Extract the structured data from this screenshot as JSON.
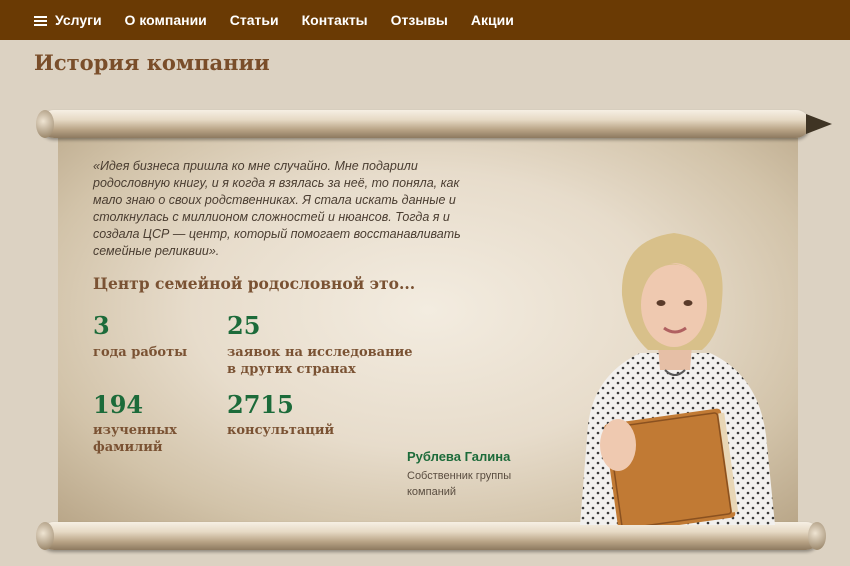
{
  "nav": {
    "items": [
      {
        "label": "Услуги",
        "icon": "menu-icon"
      },
      {
        "label": "О компании"
      },
      {
        "label": "Статьи"
      },
      {
        "label": "Контакты"
      },
      {
        "label": "Отзывы"
      },
      {
        "label": "Акции"
      }
    ]
  },
  "page": {
    "title": "История компании"
  },
  "quote": {
    "lines": [
      "«Идея бизнеса пришла ко мне случайно. Мне подарили",
      "родословную книгу, и я когда я взялась за неё, то поняла, как",
      "мало знаю о своих родственниках. Я стала искать данные и",
      "столкнулась с миллионом сложностей и нюансов. Тогда я и",
      "создала ЦСР — центр, который помогает восстанавливать",
      "семейные реликвии»."
    ]
  },
  "subtitle": "Центр семейной родословной это...",
  "stats": [
    {
      "value": "3",
      "label_lines": [
        "года работы"
      ]
    },
    {
      "value": "25",
      "label_lines": [
        "заявок на исследование",
        "в других странах"
      ]
    },
    {
      "value": "194",
      "label_lines": [
        "изученных",
        "фамилий"
      ]
    },
    {
      "value": "2715",
      "label_lines": [
        "консультаций"
      ]
    }
  ],
  "person": {
    "name": "Рублева Галина",
    "role_lines": [
      "Собственник группы",
      "компаний"
    ]
  },
  "colors": {
    "nav_bg": "#6a3a04",
    "accent_green": "#1c6b3a",
    "heading_brown": "#7a4e2a",
    "page_bg": "#dcd2c2"
  }
}
